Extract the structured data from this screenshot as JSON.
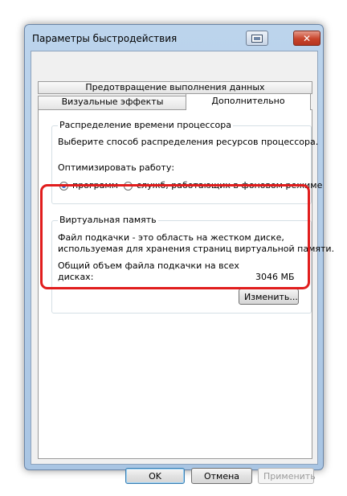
{
  "window": {
    "title": "Параметры быстродействия",
    "close_symbol": "✕"
  },
  "tabs": {
    "prevent": "Предотвращение выполнения данных",
    "visual": "Визуальные эффекты",
    "advanced": "Дополнительно"
  },
  "cpu_group": {
    "legend": "Распределение времени процессора",
    "description": "Выберите способ распределения ресурсов процессора.",
    "optimize_label": "Оптимизировать работу:",
    "option_programs": "программ",
    "option_services": "служб, работающих в фоновом режиме",
    "selected": "программ"
  },
  "vm_group": {
    "legend": "Виртуальная память",
    "description_line1": "Файл подкачки - это область на жестком диске,",
    "description_line2": "используемая для хранения страниц виртуальной памяти.",
    "total_line1": "Общий объем файла подкачки на всех",
    "total_line2": "дисках:",
    "total_value": "3046 МБ",
    "change_button": "Изменить..."
  },
  "footer": {
    "ok": "OK",
    "cancel": "Отмена",
    "apply": "Применить"
  },
  "colors": {
    "highlight": "#e11d1d",
    "radio_dot": "#2a6fd0"
  }
}
